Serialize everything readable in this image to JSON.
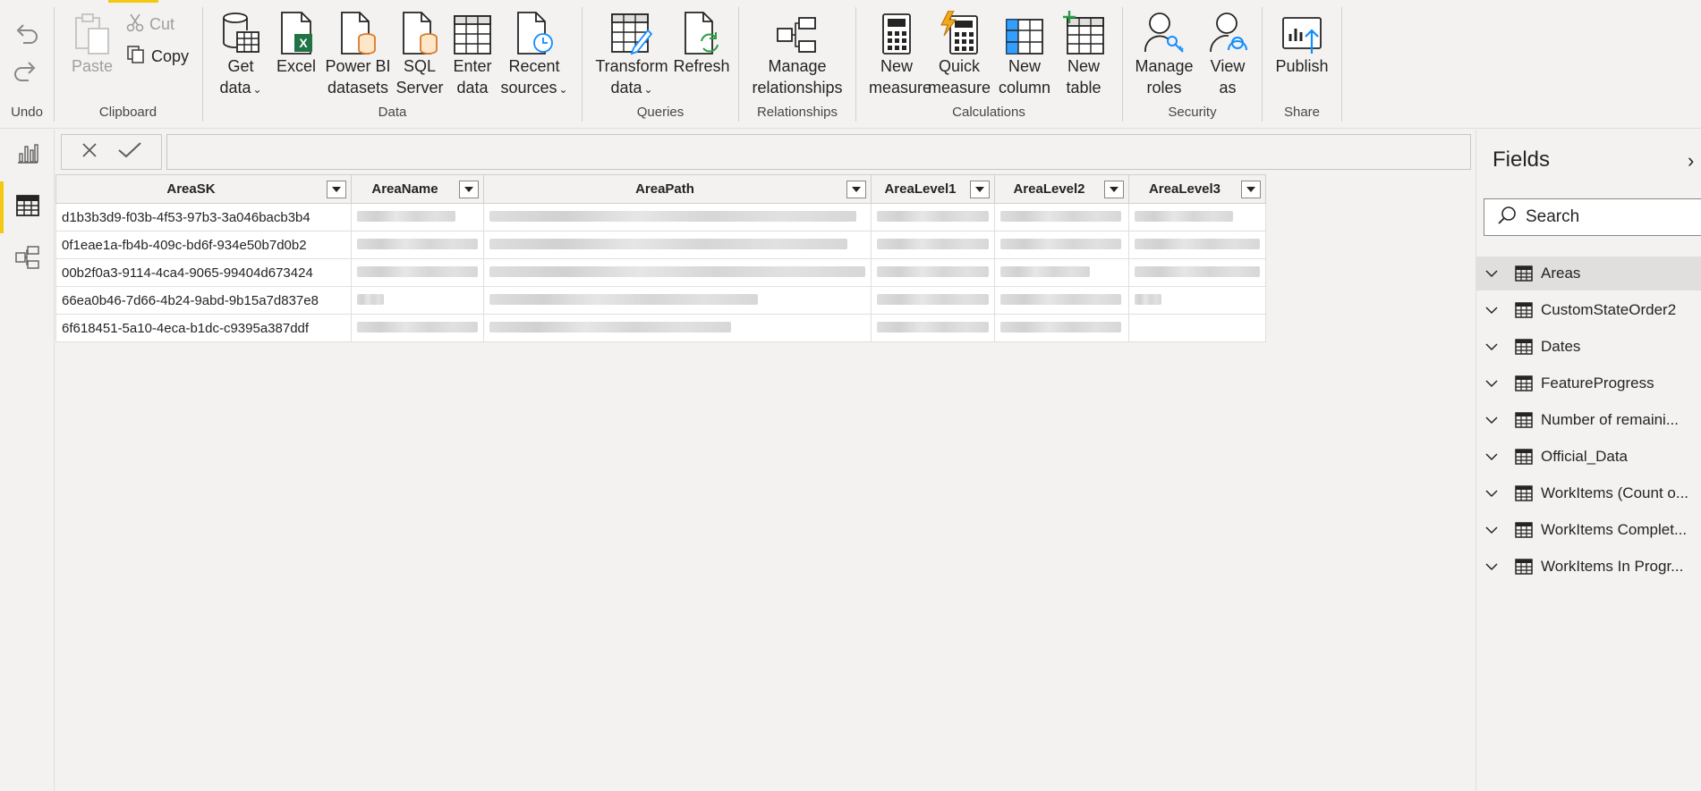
{
  "ribbon": {
    "undo": {
      "group_label": "Undo"
    },
    "clipboard": {
      "group_label": "Clipboard",
      "paste": "Paste",
      "cut": "Cut",
      "copy": "Copy"
    },
    "data": {
      "group_label": "Data",
      "get_data": [
        "Get",
        "data"
      ],
      "excel": [
        "Excel"
      ],
      "power_bi_datasets": [
        "Power BI",
        "datasets"
      ],
      "sql_server": [
        "SQL",
        "Server"
      ],
      "enter_data": [
        "Enter",
        "data"
      ],
      "recent_sources": [
        "Recent",
        "sources"
      ]
    },
    "queries": {
      "group_label": "Queries",
      "transform_data": [
        "Transform",
        "data"
      ],
      "refresh": [
        "Refresh"
      ]
    },
    "relationships": {
      "group_label": "Relationships",
      "manage_relationships": [
        "Manage",
        "relationships"
      ]
    },
    "calculations": {
      "group_label": "Calculations",
      "new_measure": [
        "New",
        "measure"
      ],
      "quick_measure": [
        "Quick",
        "measure"
      ],
      "new_column": [
        "New",
        "column"
      ],
      "new_table": [
        "New",
        "table"
      ]
    },
    "security": {
      "group_label": "Security",
      "manage_roles": [
        "Manage",
        "roles"
      ],
      "view_as": [
        "View",
        "as"
      ]
    },
    "share": {
      "group_label": "Share",
      "publish": [
        "Publish"
      ]
    }
  },
  "table": {
    "columns": [
      "AreaSK",
      "AreaName",
      "AreaPath",
      "AreaLevel1",
      "AreaLevel2",
      "AreaLevel3"
    ],
    "rows": [
      "d1b3b3d9-f03b-4f53-97b3-3a046bacb3b4",
      "0f1eae1a-fb4b-409c-bd6f-934e50b7d0b2",
      "00b2f0a3-9114-4ca4-9065-99404d673424",
      "66ea0b46-7d66-4b24-9abd-9b15a7d837e8",
      "6f618451-5a10-4eca-b1dc-c9395a387ddf"
    ]
  },
  "fields": {
    "title": "Fields",
    "search_placeholder": "Search",
    "items": [
      "Areas",
      "CustomStateOrder2",
      "Dates",
      "FeatureProgress",
      "Number of remaini...",
      "Official_Data",
      "WorkItems (Count o...",
      "WorkItems Complet...",
      "WorkItems In Progr..."
    ],
    "selected": "Areas"
  },
  "colors": {
    "accent": "#f2c811",
    "excel_green": "#217346",
    "powerbi_blue": "#118dff"
  }
}
